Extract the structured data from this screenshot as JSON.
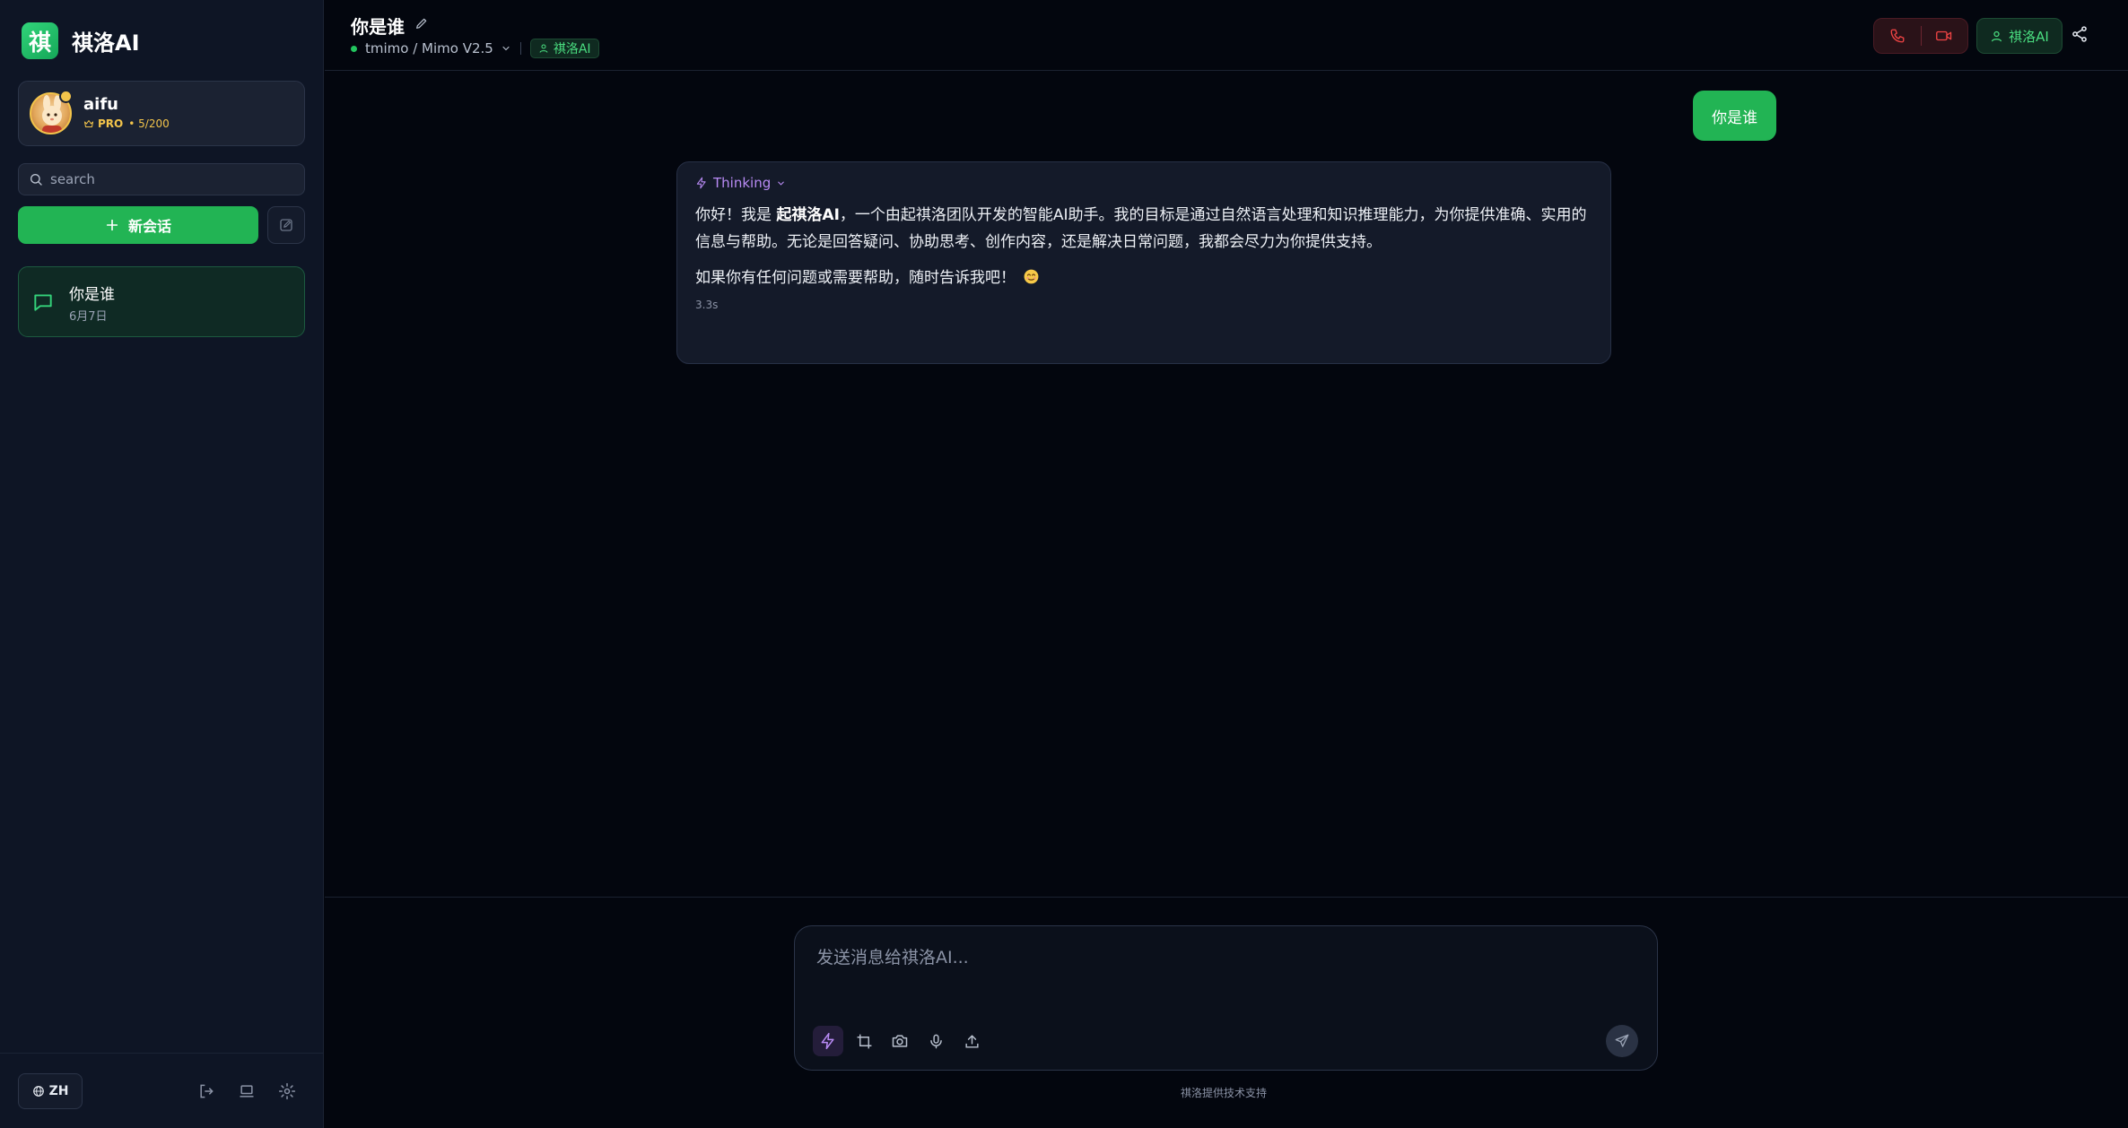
{
  "brand": {
    "logo_char": "祺",
    "name": "祺洛AI"
  },
  "user": {
    "name": "aifu",
    "plan": "PRO",
    "quota": "• 5/200"
  },
  "search": {
    "placeholder": "search"
  },
  "sidebar": {
    "new_chat_label": "新会话",
    "conversations": [
      {
        "title": "你是谁",
        "date": "6月7日"
      }
    ],
    "lang_label": "ZH"
  },
  "header": {
    "title": "你是谁",
    "model": "tmimo / Mimo V2.5",
    "agent_badge": "祺洛AI",
    "agent_pill": "祺洛AI"
  },
  "messages": {
    "user": "你是谁",
    "thinking_label": "Thinking",
    "ai_line1_prefix": "你好！我是 ",
    "ai_line1_bold": "起祺洛AI",
    "ai_line1_rest": "，一个由起祺洛团队开发的智能AI助手。我的目标是通过自然语言处理和知识推理能力，为你提供准确、实用的信息与帮助。无论是回答疑问、协助思考、创作内容，还是解决日常问题，我都会尽力为你提供支持。",
    "ai_line2": "如果你有任何问题或需要帮助，随时告诉我吧！",
    "elapsed": "3.3s"
  },
  "composer": {
    "placeholder": "发送消息给祺洛AI..."
  },
  "footer": {
    "powered": "祺洛提供技术支持"
  },
  "colors": {
    "accent_green": "#22b454",
    "thinking_purple": "#b98bf5",
    "call_red": "#ef4444",
    "pro_gold": "#f3c44b"
  },
  "icons": {
    "brand": "brand-logo-icon",
    "search": "search-icon",
    "plus": "plus-icon",
    "compose": "compose-icon",
    "chat": "chat-bubble-icon",
    "globe": "globe-icon",
    "logout": "logout-icon",
    "laptop": "laptop-icon",
    "settings": "gear-icon",
    "edit": "pencil-icon",
    "phone": "phone-icon",
    "video": "video-icon",
    "person": "person-icon",
    "share": "share-icon",
    "bolt": "lightning-icon",
    "crop": "crop-icon",
    "camera": "camera-icon",
    "mic": "microphone-icon",
    "upload": "upload-icon",
    "send": "send-icon",
    "smile": "smile-emoji-icon"
  }
}
